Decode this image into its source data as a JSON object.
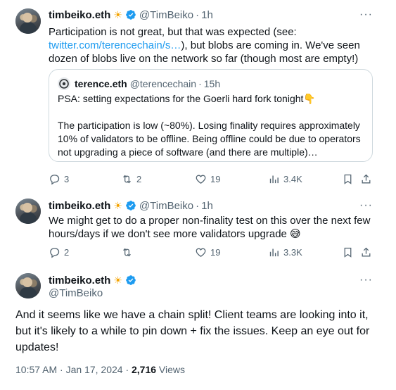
{
  "tweets": [
    {
      "name": "timbeiko.eth",
      "emoji": "☀",
      "handle": "@TimBeiko",
      "separator": "·",
      "time": "1h",
      "text_before_link": "Participation is not great, but that was expected (see: ",
      "link": "twitter.com/terencechain/s…",
      "text_after_link": "), but blobs are coming in. We've seen dozen of blobs live on the network so far (though most are empty!)",
      "quote": {
        "name": "terence.eth",
        "handle": "@terencechain",
        "separator": "·",
        "time": "15h",
        "line1": "PSA: setting expectations for the Goerli hard fork tonight👇",
        "line2": "The participation is low (~80%). Losing finality requires approximately 10% of validators to be offline. Being offline could be due to operators not upgrading a piece of software (and there are multiple)…"
      },
      "replies": "3",
      "reposts": "2",
      "likes": "19",
      "views": "3.4K"
    },
    {
      "name": "timbeiko.eth",
      "emoji": "☀",
      "handle": "@TimBeiko",
      "separator": "·",
      "time": "1h",
      "text": "We might get to do a proper non-finality test on this over the next few hours/days if we don't see more validators upgrade 😅",
      "replies": "2",
      "reposts": "",
      "likes": "19",
      "views": "3.3K"
    }
  ],
  "main_tweet": {
    "name": "timbeiko.eth",
    "emoji": "☀",
    "handle": "@TimBeiko",
    "text": "And it seems like we have a chain split! Client teams are looking into it, but it's likely to a while to pin down + fix the issues. Keep an eye out for updates!",
    "timestamp": "10:57 AM · Jan 17, 2024 · ",
    "views_count": "2,716",
    "views_label": " Views"
  },
  "more_glyph": "···",
  "colors": {
    "link": "#1d9bf0",
    "verified": "#1d9bf0",
    "secondary_text": "#536471",
    "border": "#cfd9de"
  },
  "icons": [
    "more-icon",
    "verified-icon",
    "reply-icon",
    "repost-icon",
    "like-icon",
    "views-icon",
    "bookmark-icon",
    "share-icon"
  ]
}
